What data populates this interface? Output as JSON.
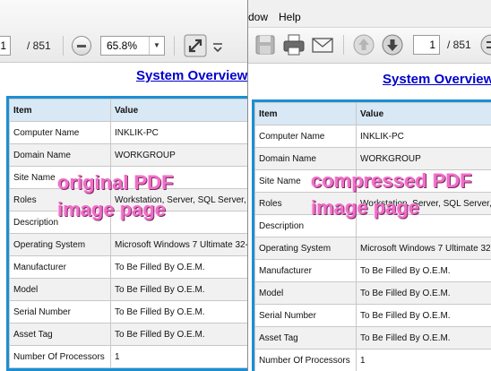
{
  "left": {
    "toolbar": {
      "page_value": "1",
      "page_total": "/ 851",
      "zoom": "65.8%"
    },
    "document": {
      "title": "System Overview"
    },
    "overlay": {
      "line1": "original PDF",
      "line2": "image page"
    }
  },
  "right": {
    "menu": {
      "item1": "dow",
      "item2": "Help"
    },
    "toolbar": {
      "page_value": "1",
      "page_total": "/ 851"
    },
    "document": {
      "title": "System Overview"
    },
    "overlay": {
      "line1": "compressed PDF",
      "line2": "image page"
    }
  },
  "table": {
    "headers": [
      "Item",
      "Value"
    ],
    "rows": [
      [
        "Computer Name",
        "INKLIK-PC"
      ],
      [
        "Domain Name",
        "WORKGROUP"
      ],
      [
        "Site Name",
        ""
      ],
      [
        "Roles",
        "Workstation, Server, SQL Server,"
      ],
      [
        "Description",
        ""
      ],
      [
        "Operating System",
        "Microsoft Windows 7 Ultimate 32-"
      ],
      [
        "Manufacturer",
        "To Be Filled By O.E.M."
      ],
      [
        "Model",
        "To Be Filled By O.E.M."
      ],
      [
        "Serial Number",
        "To Be Filled By O.E.M."
      ],
      [
        "Asset Tag",
        "To Be Filled By O.E.M."
      ],
      [
        "Number Of Processors",
        "1"
      ]
    ]
  },
  "icons": [
    "minus-icon",
    "dropdown-arrow-icon",
    "fullscreen-icon",
    "more-icon",
    "save-icon",
    "print-icon",
    "email-icon",
    "previous-page-icon",
    "next-page-icon",
    "fit-page-icon"
  ]
}
